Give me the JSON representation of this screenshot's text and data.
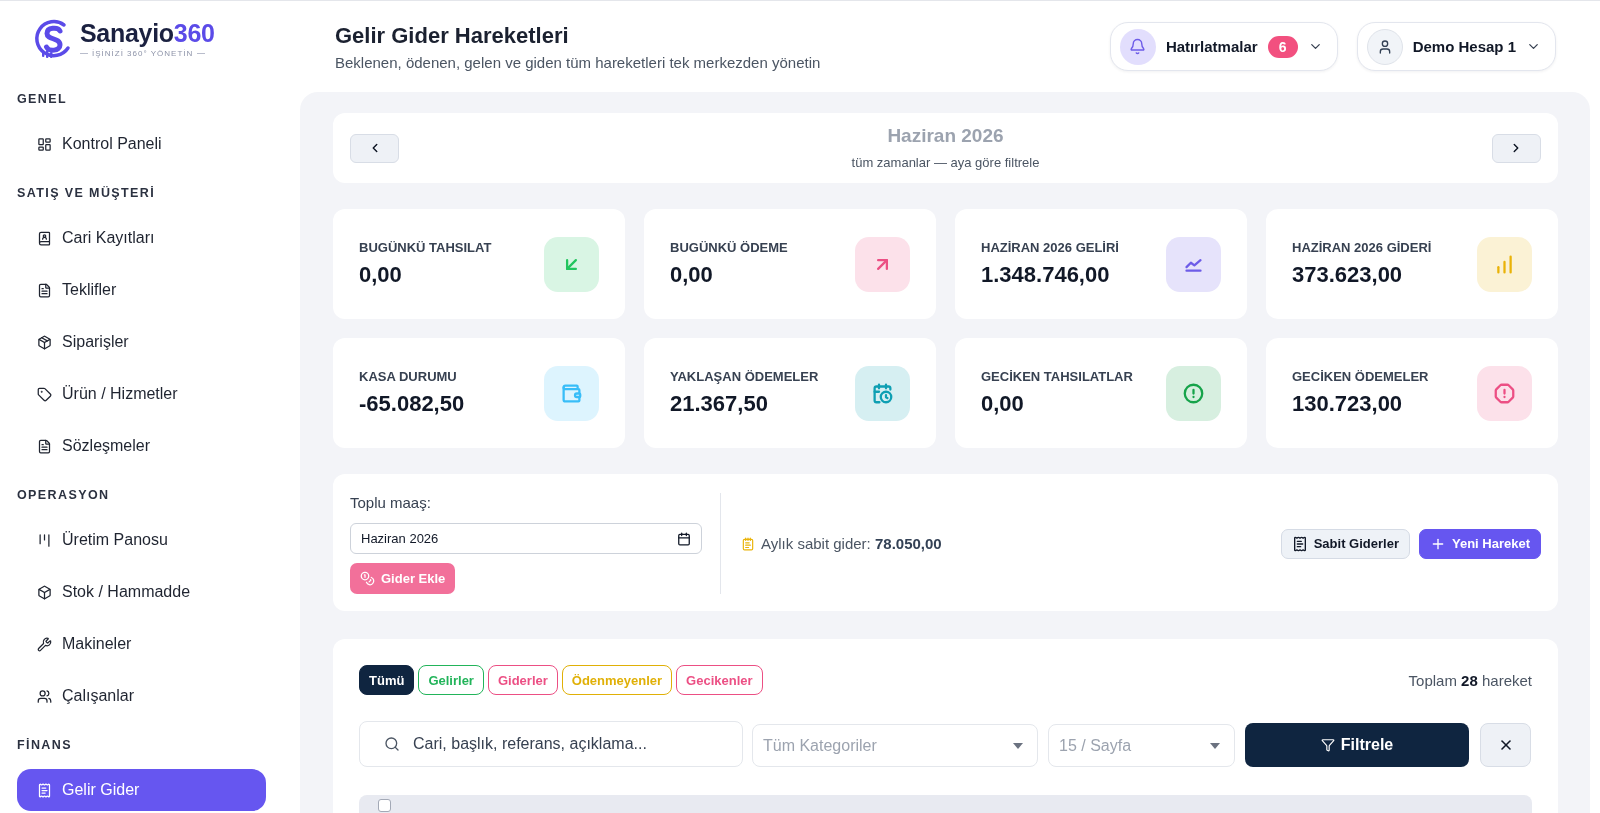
{
  "logo": {
    "name": "Sanayio",
    "suffix": "360",
    "tagline": "İŞİNİZİ 360° YÖNETİN"
  },
  "sidebar": {
    "sections": [
      {
        "title": "GENEL",
        "items": [
          {
            "label": "Kontrol Paneli",
            "selected": false
          }
        ]
      },
      {
        "title": "SATIŞ VE MÜŞTERİ",
        "items": [
          {
            "label": "Cari Kayıtları",
            "selected": false
          },
          {
            "label": "Teklifler",
            "selected": false
          },
          {
            "label": "Siparişler",
            "selected": false
          },
          {
            "label": "Ürün / Hizmetler",
            "selected": false
          },
          {
            "label": "Sözleşmeler",
            "selected": false
          }
        ]
      },
      {
        "title": "OPERASYON",
        "items": [
          {
            "label": "Üretim Panosu",
            "selected": false
          },
          {
            "label": "Stok / Hammadde",
            "selected": false
          },
          {
            "label": "Makineler",
            "selected": false
          },
          {
            "label": "Çalışanlar",
            "selected": false
          }
        ]
      },
      {
        "title": "FİNANS",
        "items": [
          {
            "label": "Gelir Gider",
            "selected": true
          }
        ]
      }
    ]
  },
  "header": {
    "title": "Gelir Gider Hareketleri",
    "subtitle": "Beklenen, ödenen, gelen ve giden tüm hareketleri tek merkezden yönetin",
    "reminders": {
      "label": "Hatırlatmalar",
      "count": "6"
    },
    "account": {
      "label": "Demo Hesap 1"
    }
  },
  "month_nav": {
    "title": "Haziran 2026",
    "subtitle": "tüm zamanlar — aya göre filtrele"
  },
  "stats": [
    {
      "label": "BUGÜNKÜ TAHSILAT",
      "value": "0,00",
      "color": "#22c55e"
    },
    {
      "label": "BUGÜNKÜ ÖDEME",
      "value": "0,00",
      "color": "#ec4f84"
    },
    {
      "label": "HAZİRAN 2026 GELİRİ",
      "value": "1.348.746,00",
      "color": "#6d5ce8"
    },
    {
      "label": "HAZİRAN 2026 GİDERİ",
      "value": "373.623,00",
      "color": "#eab308"
    },
    {
      "label": "KASA DURUMU",
      "value": "-65.082,50",
      "color": "#38bdf8"
    },
    {
      "label": "YAKLAŞAN ÖDEMELER",
      "value": "21.367,50",
      "color": "#0e9fb3"
    },
    {
      "label": "GECİKEN TAHSILATLAR",
      "value": "0,00",
      "color": "#16a34a"
    },
    {
      "label": "GECİKEN ÖDEMELER",
      "value": "130.723,00",
      "color": "#ec4f84"
    }
  ],
  "bulk_salary": {
    "label": "Toplu maaş:",
    "month": {
      "value": "Haziran 2026"
    },
    "button": "Gider Ekle",
    "fixed_expense": "Aylık sabit gider: **78.050,00**",
    "buttons": [
      {
        "label": "Sabit Giderler",
        "kind": "secondary"
      },
      {
        "label": "Yeni Hareket",
        "kind": "primary"
      }
    ]
  },
  "transactions": {
    "filters": [
      {
        "label": "Tümü",
        "selected": true,
        "color": "#0f2540"
      },
      {
        "label": "Gelirler",
        "selected": false,
        "color": "#22b45a"
      },
      {
        "label": "Giderler",
        "selected": false,
        "color": "#ec4f84"
      },
      {
        "label": "Ödenmeyenler",
        "selected": false,
        "color": "#e0b007"
      },
      {
        "label": "Gecikenler",
        "selected": false,
        "color": "#ec4f84"
      }
    ],
    "total": "Toplam **28** hareket",
    "search": {
      "placeholder": "Cari, başlık, referans, açıklama..."
    },
    "category": {
      "placeholder": "Tüm Kategoriler"
    },
    "page_size": {
      "placeholder": "15 / Sayfa"
    },
    "filter_button": "Filtrele",
    "table": {
      "select_all": {
        "checked": false
      }
    }
  }
}
